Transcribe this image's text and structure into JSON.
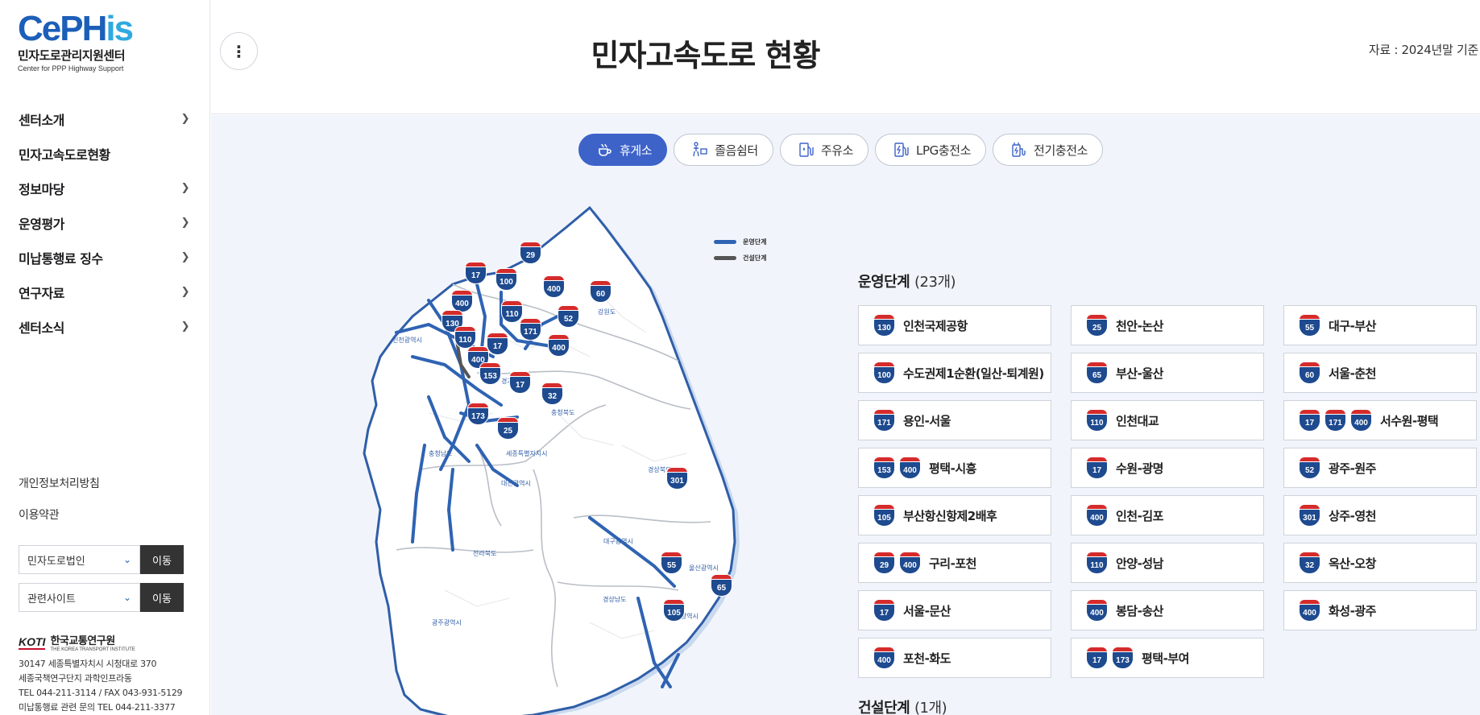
{
  "sidebar": {
    "logo": {
      "mark_a": "CePH",
      "mark_b": "is",
      "name_ko": "민자도로관리지원센터",
      "name_en": "Center for PPP Highway Support"
    },
    "nav": [
      {
        "label": "센터소개",
        "has_children": true
      },
      {
        "label": "민자고속도로현황",
        "has_children": false
      },
      {
        "label": "정보마당",
        "has_children": true
      },
      {
        "label": "운영평가",
        "has_children": true
      },
      {
        "label": "미납통행료 징수",
        "has_children": true
      },
      {
        "label": "연구자료",
        "has_children": true
      },
      {
        "label": "센터소식",
        "has_children": true
      }
    ],
    "links": [
      "개인정보처리방침",
      "이용약관"
    ],
    "select1": {
      "value": "민자도로법인",
      "button": "이동"
    },
    "select2": {
      "value": "관련사이트",
      "button": "이동"
    },
    "koti": {
      "mark": "KOTI",
      "name": "한국교통연구원",
      "sub": "THE KOREA TRANSPORT INSTITUTE"
    },
    "address": [
      "30147 세종특별자치시 시청대로 370",
      "세종국책연구단지 과학인프라동",
      "TEL 044-211-3114 / FAX 043-931-5129",
      "미납통행료 관련 문의 TEL 044-211-3377"
    ]
  },
  "header": {
    "title": "민자고속도로 현황",
    "source": "자료 : 2024년말 기준"
  },
  "tabs": [
    {
      "label": "휴게소",
      "icon": "coffee-icon",
      "active": true
    },
    {
      "label": "졸음쉼터",
      "icon": "rest-icon",
      "active": false
    },
    {
      "label": "주유소",
      "icon": "fuel-icon",
      "active": false
    },
    {
      "label": "LPG충전소",
      "icon": "lpg-icon",
      "active": false
    },
    {
      "label": "전기충전소",
      "icon": "ev-charger-icon",
      "active": false
    }
  ],
  "map": {
    "legend": [
      {
        "label": "운영단계",
        "color": "#2f63b3"
      },
      {
        "label": "건설단계",
        "color": "#555555"
      }
    ],
    "regions": [
      "강원도",
      "인천광역시",
      "경기도",
      "충청북도",
      "충청남도",
      "세종특별자치시",
      "대전광역시",
      "경상북도",
      "전라북도",
      "대구광역시",
      "울산광역시",
      "경상남도",
      "부산광역시",
      "광주광역시"
    ],
    "shields": [
      "29",
      "17",
      "100",
      "400",
      "60",
      "400",
      "110",
      "130",
      "52",
      "171",
      "110",
      "17",
      "400",
      "400",
      "153",
      "17",
      "32",
      "173",
      "25",
      "301",
      "55",
      "65",
      "105"
    ]
  },
  "operating": {
    "title": "운영단계",
    "count": "(23개)",
    "routes": [
      {
        "shields": [
          "130"
        ],
        "name": "인천국제공항"
      },
      {
        "shields": [
          "25"
        ],
        "name": "천안-논산"
      },
      {
        "shields": [
          "55"
        ],
        "name": "대구-부산"
      },
      {
        "shields": [
          "100"
        ],
        "name": "수도권제1순환(일산-퇴계원)"
      },
      {
        "shields": [
          "65"
        ],
        "name": "부산-울산"
      },
      {
        "shields": [
          "60"
        ],
        "name": "서울-춘천"
      },
      {
        "shields": [
          "171"
        ],
        "name": "용인-서울"
      },
      {
        "shields": [
          "110"
        ],
        "name": "인천대교"
      },
      {
        "shields": [
          "17",
          "171",
          "400"
        ],
        "name": "서수원-평택"
      },
      {
        "shields": [
          "153",
          "400"
        ],
        "name": "평택-시흥"
      },
      {
        "shields": [
          "17"
        ],
        "name": "수원-광명"
      },
      {
        "shields": [
          "52"
        ],
        "name": "광주-원주"
      },
      {
        "shields": [
          "105"
        ],
        "name": "부산항신항제2배후"
      },
      {
        "shields": [
          "400"
        ],
        "name": "인천-김포"
      },
      {
        "shields": [
          "301"
        ],
        "name": "상주-영천"
      },
      {
        "shields": [
          "29",
          "400"
        ],
        "name": "구리-포천"
      },
      {
        "shields": [
          "110"
        ],
        "name": "안양-성남"
      },
      {
        "shields": [
          "32"
        ],
        "name": "옥산-오창"
      },
      {
        "shields": [
          "17"
        ],
        "name": "서울-문산"
      },
      {
        "shields": [
          "400"
        ],
        "name": "봉담-송산"
      },
      {
        "shields": [
          "400"
        ],
        "name": "화성-광주"
      },
      {
        "shields": [
          "400"
        ],
        "name": "포천-화도"
      },
      {
        "shields": [
          "17",
          "173"
        ],
        "name": "평택-부여"
      }
    ]
  },
  "construction": {
    "title": "건설단계",
    "count": "(1개)"
  }
}
